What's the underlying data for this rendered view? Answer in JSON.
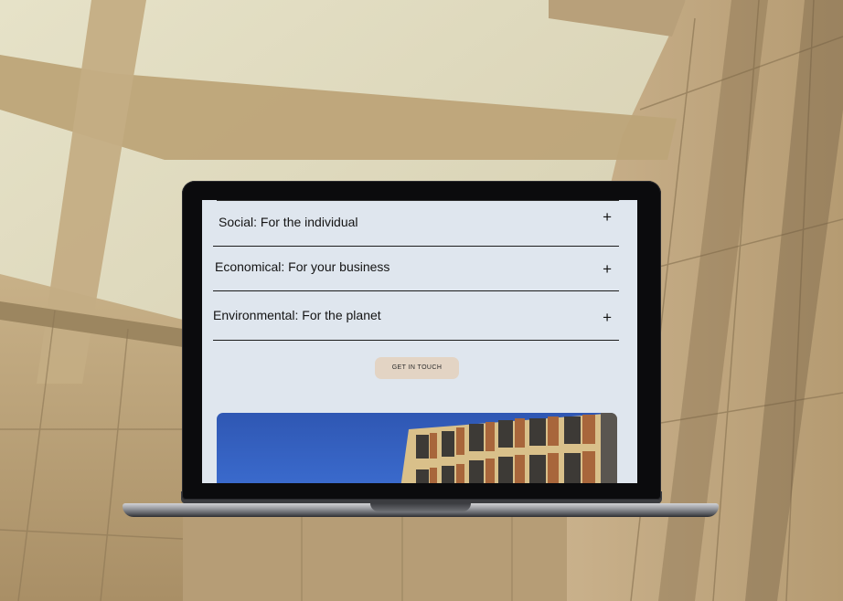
{
  "accordion": {
    "items": [
      {
        "label": "Social: For the individual",
        "toggle": "+"
      },
      {
        "label": "Economical: For your business",
        "toggle": "+"
      },
      {
        "label": "Environmental: For the planet",
        "toggle": "+"
      }
    ]
  },
  "cta": {
    "label": "GET IN TOUCH"
  },
  "colors": {
    "screen_bg": "#dfe6ee",
    "cta_bg": "#e3d4c4",
    "sky": "#3c6dd0",
    "brick": "#d9c08a",
    "wood": "#a8663b"
  },
  "hero_image": {
    "icon": "building-photo"
  }
}
